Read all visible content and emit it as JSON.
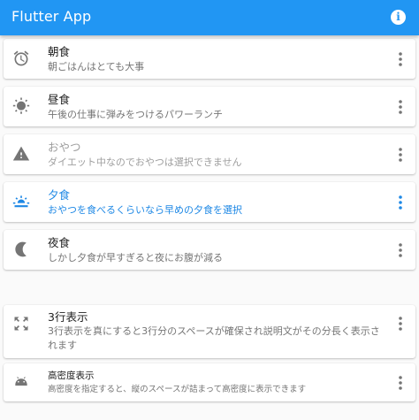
{
  "app_bar": {
    "title": "Flutter App",
    "info_icon": "info-icon",
    "info_glyph": "i",
    "color": "#2196f3"
  },
  "items": [
    {
      "title": "朝食",
      "subtitle": "朝ごはんはとても大事",
      "icon": "alarm-icon",
      "state": "normal"
    },
    {
      "title": "昼食",
      "subtitle": "午後の仕事に弾みをつけるパワーランチ",
      "icon": "sun-icon",
      "state": "normal"
    },
    {
      "title": "おやつ",
      "subtitle": "ダイエット中なのでおやつは選択できません",
      "icon": "warning-icon",
      "state": "disabled"
    },
    {
      "title": "夕食",
      "subtitle": "おやつを食べるくらいなら早めの夕食を選択",
      "icon": "sunset-icon",
      "state": "selected"
    },
    {
      "title": "夜食",
      "subtitle": "しかし夕食が早すぎると夜にお腹が減る",
      "icon": "moon-icon",
      "state": "normal"
    },
    {
      "title": "3行表示",
      "subtitle": "3行表示を真にすると3行分のスペースが確保され説明文がその分長く表示されます",
      "icon": "expand-icon",
      "state": "normal"
    },
    {
      "title": "高密度表示",
      "subtitle": "高密度を指定すると、縦のスペースが詰まって高密度に表示できます",
      "icon": "android-icon",
      "state": "normal"
    }
  ],
  "more_icon": "more-vert-icon",
  "colors": {
    "selected": "#1e88e5",
    "disabled": "#9e9e9e",
    "icon": "#757575"
  }
}
